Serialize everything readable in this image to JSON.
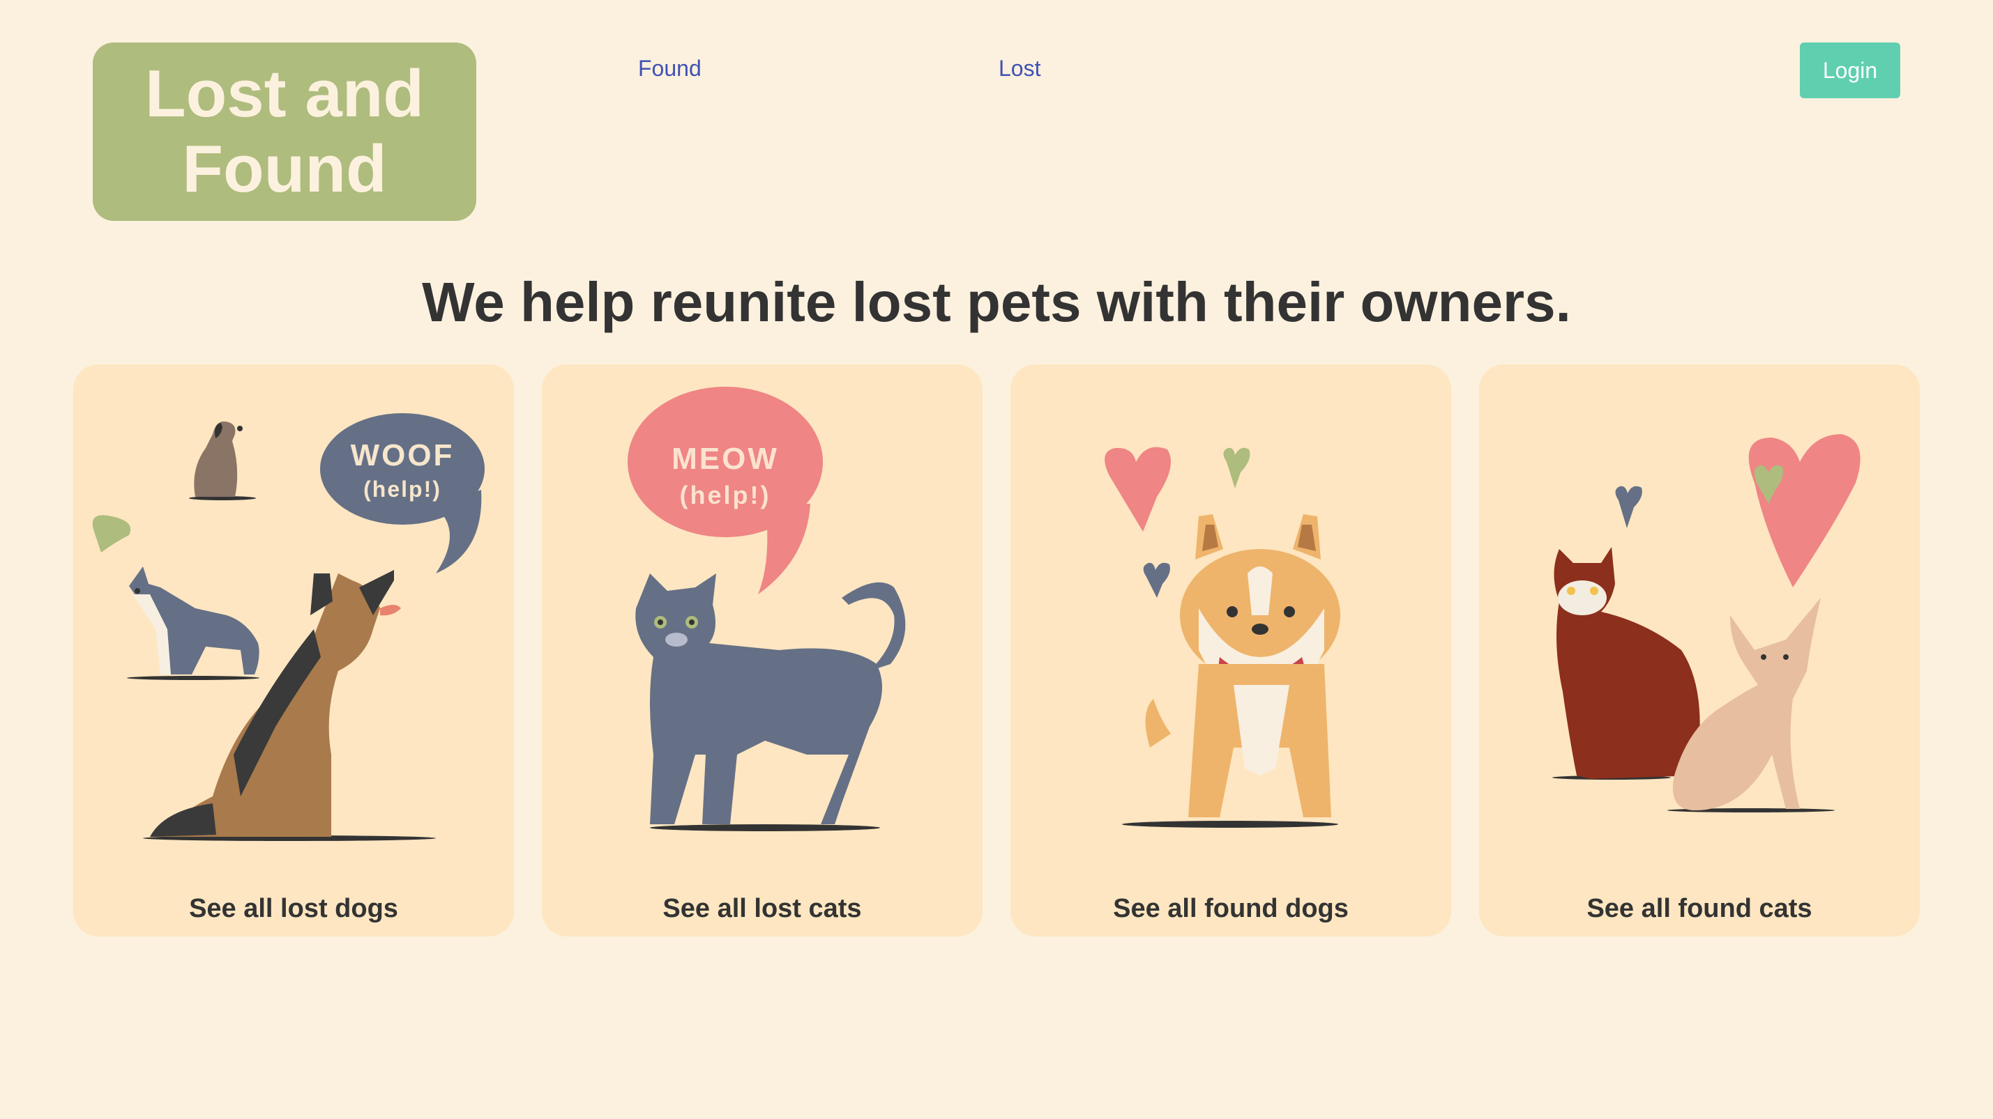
{
  "header": {
    "logo_line1": "Lost and",
    "logo_line2": "Found",
    "nav": {
      "found": "Found",
      "lost": "Lost"
    },
    "login": "Login"
  },
  "headline": "We help reunite lost pets with their owners.",
  "cards": [
    {
      "label": "See all lost dogs",
      "bubble_word": "WOOF",
      "bubble_sub": "(help!)"
    },
    {
      "label": "See all lost cats",
      "bubble_word": "MEOW",
      "bubble_sub": "(help!)"
    },
    {
      "label": "See all found dogs"
    },
    {
      "label": "See all found cats"
    }
  ],
  "colors": {
    "page_bg": "#fcf1de",
    "card_bg": "#fde6c1",
    "logo_bg": "#aebc7e",
    "login_bg": "#5fcfb0",
    "nav_link": "#3f51b5",
    "text": "#333333"
  }
}
